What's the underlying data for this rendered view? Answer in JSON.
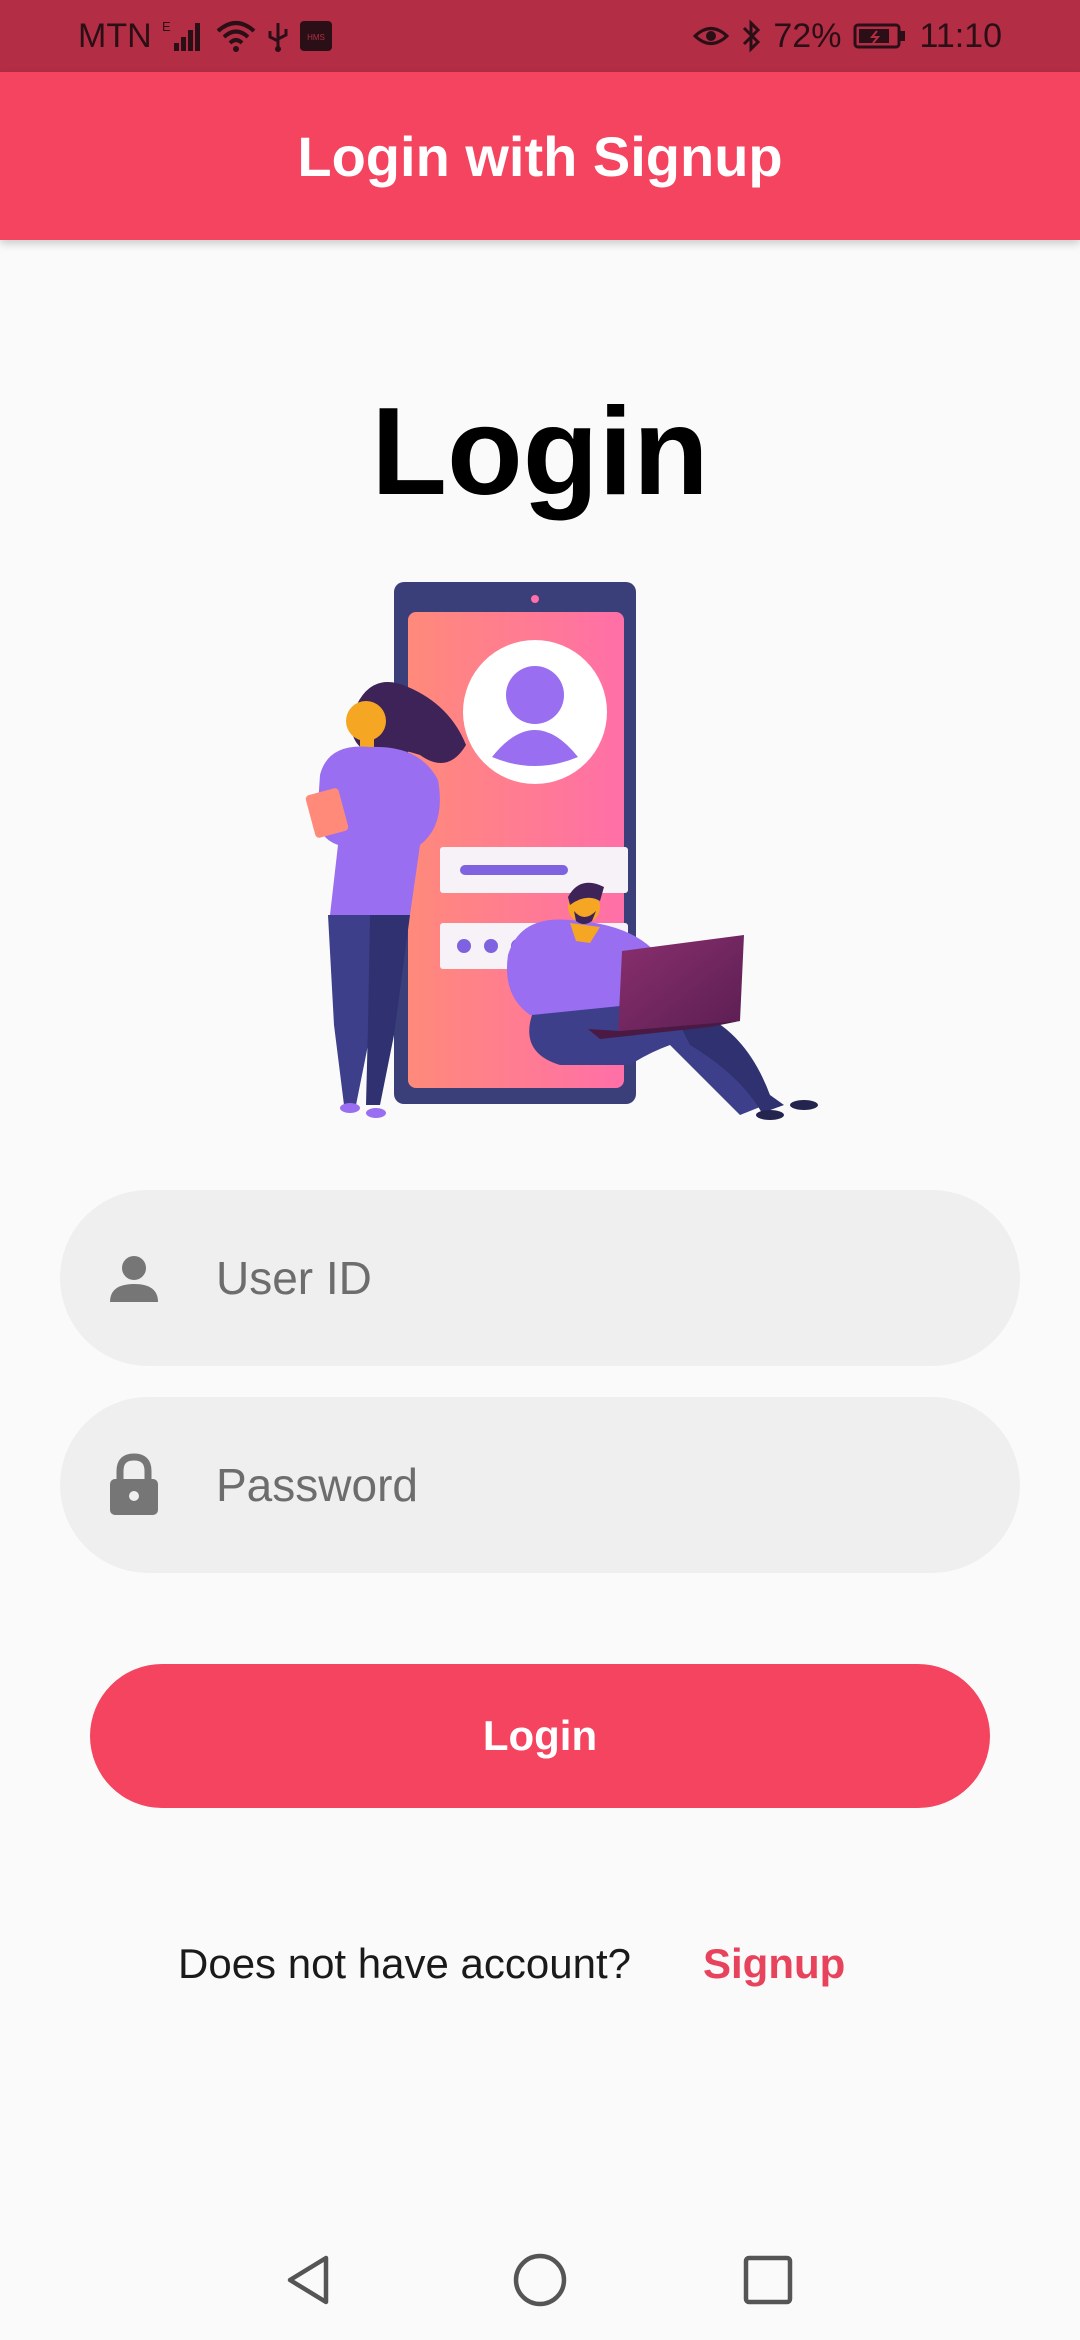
{
  "status_bar": {
    "carrier": "MTN",
    "network_type": "E",
    "battery": "72%",
    "time": "11:10",
    "icons": [
      "signal-icon",
      "wifi-icon",
      "usb-icon",
      "hms-icon",
      "eye-icon",
      "bluetooth-icon",
      "battery-icon"
    ],
    "hms_label": "HMS"
  },
  "app_bar": {
    "title": "Login with Signup",
    "color": "#f5445f"
  },
  "page": {
    "title": "Login",
    "illustration": "login-illustration"
  },
  "form": {
    "user_id": {
      "placeholder": "User ID",
      "value": "",
      "icon": "person-icon"
    },
    "password": {
      "placeholder": "Password",
      "value": "",
      "icon": "lock-icon"
    },
    "login_label": "Login"
  },
  "signup": {
    "prompt": "Does not have account?",
    "link_label": "Signup"
  },
  "nav_bar": {
    "icons": [
      "back-icon",
      "home-icon",
      "recents-icon"
    ]
  },
  "colors": {
    "accent": "#f5445f",
    "status_bar": "#b32d45",
    "field_background": "#efefef",
    "background": "#fafafa"
  }
}
